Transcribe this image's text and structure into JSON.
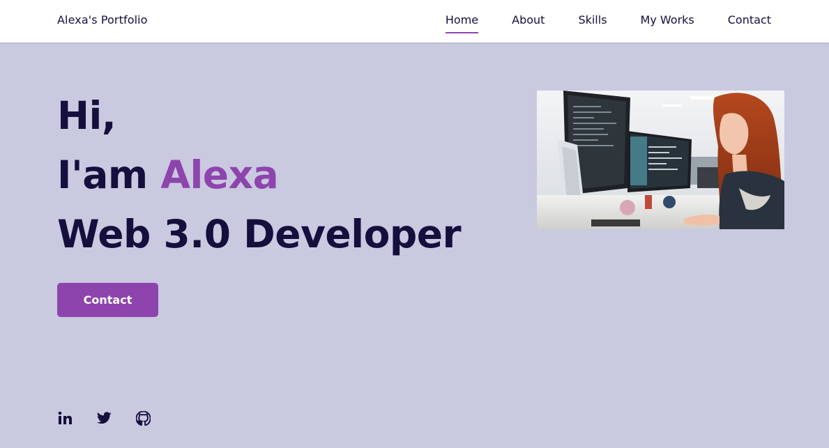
{
  "header": {
    "logo": "Alexa's Portfolio",
    "nav": [
      {
        "label": "Home",
        "active": true
      },
      {
        "label": "About",
        "active": false
      },
      {
        "label": "Skills",
        "active": false
      },
      {
        "label": "My Works",
        "active": false
      },
      {
        "label": "Contact",
        "active": false
      }
    ]
  },
  "hero": {
    "greeting": "Hi,",
    "intro_prefix": "I'am ",
    "name": "Alexa",
    "role": "Web 3.0 Developer",
    "cta_label": "Contact"
  },
  "socials": [
    {
      "icon": "linkedin-icon"
    },
    {
      "icon": "twitter-icon"
    },
    {
      "icon": "github-icon"
    }
  ],
  "colors": {
    "background": "#c9c9e0",
    "text": "#140f3d",
    "accent": "#8e44ad",
    "header": "#ffffff"
  }
}
